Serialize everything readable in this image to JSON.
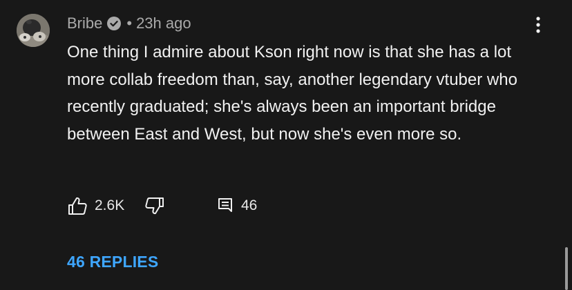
{
  "comment": {
    "author": "Bribe",
    "verified": true,
    "separator": "•",
    "time_ago": "23h ago",
    "text": "One thing I admire about Kson right now is that she has a lot more collab freedom than, say, another legendary vtuber who recently graduated; she's always been an important bridge between East and West, but now she's even more so.",
    "avatar_icon": "avatar-image",
    "menu_icon": "more-vert-icon"
  },
  "actions": {
    "like_icon": "thumbs-up-icon",
    "like_count": "2.6K",
    "dislike_icon": "thumbs-down-icon",
    "reply_icon": "comment-icon",
    "reply_count": "46"
  },
  "replies_link": "46 REPLIES",
  "colors": {
    "background": "#181818",
    "text": "#f1f1f1",
    "meta": "#aaaaaa",
    "link": "#3ea6ff"
  }
}
